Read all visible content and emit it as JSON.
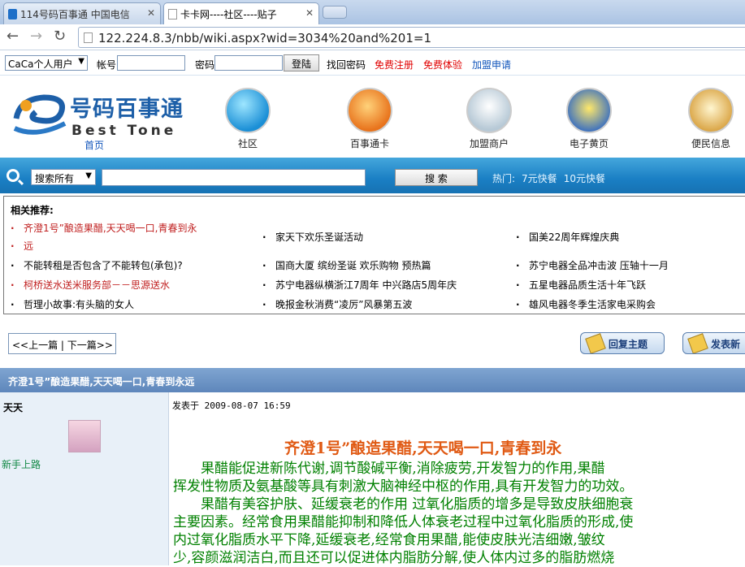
{
  "browser": {
    "tabs": [
      {
        "title": "114号码百事通 中国电信"
      },
      {
        "title": "卡卡网----社区----贴子"
      }
    ],
    "url": "122.224.8.3/nbb/wiki.aspx?wid=3034%20and%201=1"
  },
  "login": {
    "user_type": "CaCa个人用户",
    "account_label": "帐号",
    "password_label": "密码",
    "login_button": "登陆",
    "links": [
      {
        "label": "找回密码",
        "color": "#000000"
      },
      {
        "label": "免费注册",
        "color": "#e00000"
      },
      {
        "label": "免费体验",
        "color": "#e00000"
      },
      {
        "label": "加盟申请",
        "color": "#1155bb"
      }
    ]
  },
  "header": {
    "logo_cn": "号码百事通",
    "logo_en": "Best Tone",
    "home_label": "首页",
    "nav": [
      {
        "label": "社区",
        "icon": "smiley-icon"
      },
      {
        "label": "百事通卡",
        "icon": "card-icon"
      },
      {
        "label": "加盟商户",
        "icon": "shop-icon"
      },
      {
        "label": "电子黄页",
        "icon": "yellowpages-icon"
      },
      {
        "label": "便民信息",
        "icon": "book-icon"
      }
    ]
  },
  "search": {
    "scope": "搜索所有",
    "button": "搜 索",
    "hot_label": "热门:",
    "hot_items": [
      "7元快餐",
      "10元快餐"
    ]
  },
  "recommend": {
    "title": "相关推荐:",
    "items": [
      {
        "text": "齐澄1号”酿造果醋,天天喝一口,青春到永",
        "highlight": true
      },
      {
        "text": "远",
        "highlight": true
      },
      {
        "text": "家天下欢乐圣诞活动",
        "highlight": false
      },
      {
        "text": "国美22周年辉煌庆典",
        "highlight": false
      },
      {
        "text": "不能转租是否包含了不能转包(承包)?",
        "highlight": false
      },
      {
        "text": "国商大厦 缤纷圣诞 欢乐购物 预热篇",
        "highlight": false
      },
      {
        "text": "苏宁电器全品冲击波 压轴十一月",
        "highlight": false
      },
      {
        "text": "柯桥送水送米服务部－－思源送水",
        "highlight": true
      },
      {
        "text": "苏宁电器纵横浙江7周年 中兴路店5周年庆",
        "highlight": false
      },
      {
        "text": "五星电器品质生活十年飞跃",
        "highlight": false
      },
      {
        "text": "哲理小故事:有头脑的女人",
        "highlight": false
      },
      {
        "text": "晚报金秋消费“凌厉”风暴第五波",
        "highlight": false
      },
      {
        "text": "雄风电器冬季生活家电采购会",
        "highlight": false
      }
    ]
  },
  "pager": {
    "text": "<<上一篇 | 下一篇>>"
  },
  "actions": {
    "reply": "回复主题",
    "post": "发表新"
  },
  "post": {
    "header": "齐澄1号”酿造果醋,天天喝一口,青春到永远",
    "author": "天天",
    "rank": "新手上路",
    "meta": "发表于 2009-08-07 16:59",
    "title": "齐澄1号”酿造果醋,天天喝一口,青春到永",
    "body": [
      "　　果醋能促进新陈代谢,调节酸碱平衡,消除疲劳,开发智力的作用,果醋",
      "挥发性物质及氨基酸等具有刺激大脑神经中枢的作用,具有开发智力的功效。",
      "　　果醋有美容护肤、延缓衰老的作用 过氧化脂质的增多是导致皮肤细胞衰",
      "主要因素。经常食用果醋能抑制和降低人体衰老过程中过氧化脂质的形成,使",
      "内过氧化脂质水平下降,延缓衰老,经常食用果醋,能使皮肤光洁细嫩,皱纹",
      "少,容颜滋润洁白,而且还可以促进体内脂肪分解,使人体内过多的脂肪燃烧"
    ]
  }
}
